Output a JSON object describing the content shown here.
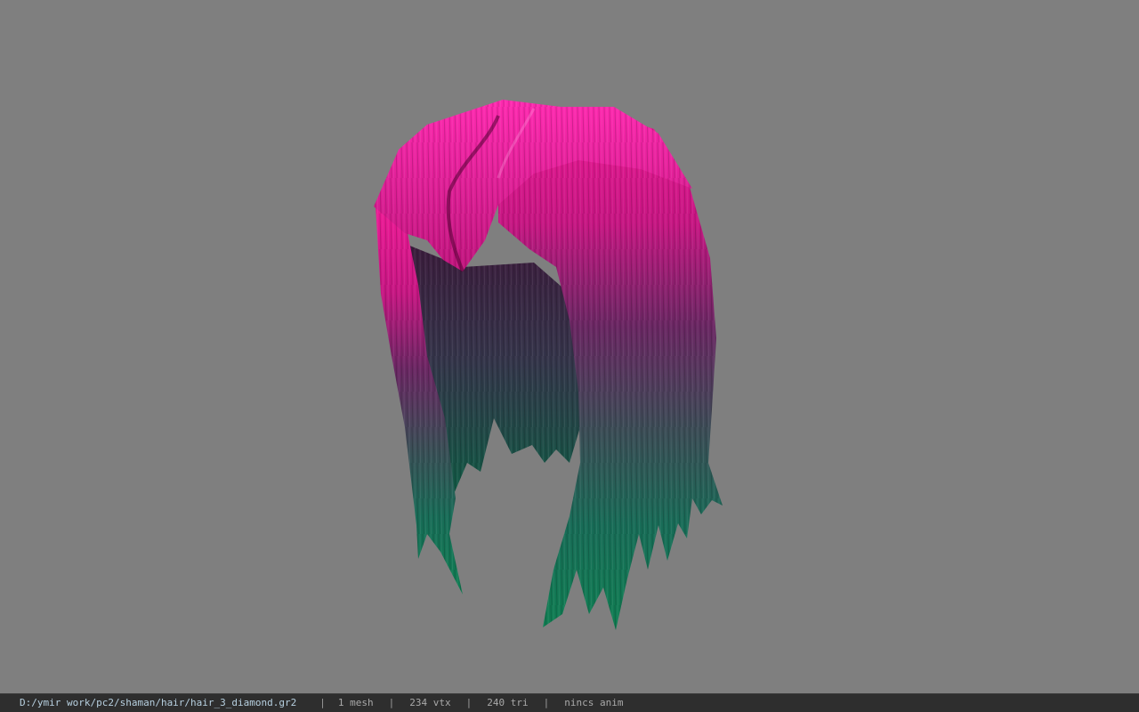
{
  "viewport": {
    "background_color": "#7f7f7f",
    "model": {
      "name": "hair-model",
      "top_color": "#e8158f",
      "mid_color": "#5a2c58",
      "bottom_color": "#13845a"
    }
  },
  "status_bar": {
    "file_path": "D:/ymir work/pc2/shaman/hair/hair_3_diamond.gr2",
    "separator": "|",
    "meshes": "1 mesh",
    "vertices": "234 vtx",
    "triangles": "240 tri",
    "animation": "nincs anim"
  }
}
